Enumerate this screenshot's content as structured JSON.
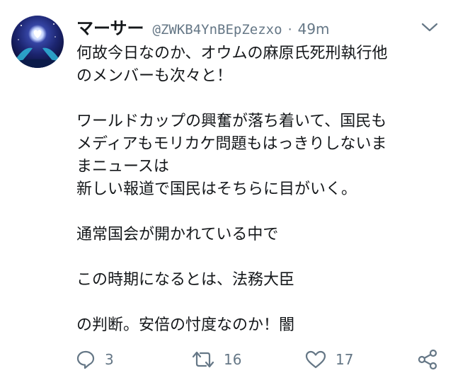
{
  "tweet": {
    "display_name": "マーサー",
    "handle": "@ZWKB4YnBEpZezxo",
    "separator": "·",
    "time": "49m",
    "lines": [
      "何故今日なのか、オウムの麻原氏死刑執行他",
      "のメンバーも次々と！",
      "",
      "ワールドカップの興奮が落ち着いて、国民も",
      "メディアもモリカケ問題もはっきりしないま",
      "まニュースは",
      "新しい報道で国民はそちらに目がいく。",
      "",
      "通常国会が開かれている中で",
      "",
      "この時期になるとは、法務大臣",
      "",
      "の判断。安倍の忖度なのか！闇"
    ]
  },
  "actions": {
    "reply_icon": "reply-icon",
    "reply_count": "3",
    "retweet_icon": "retweet-icon",
    "retweet_count": "16",
    "like_icon": "heart-icon",
    "like_count": "17",
    "share_icon": "share-icon"
  },
  "colors": {
    "text": "#14171a",
    "secondary": "#657786"
  }
}
